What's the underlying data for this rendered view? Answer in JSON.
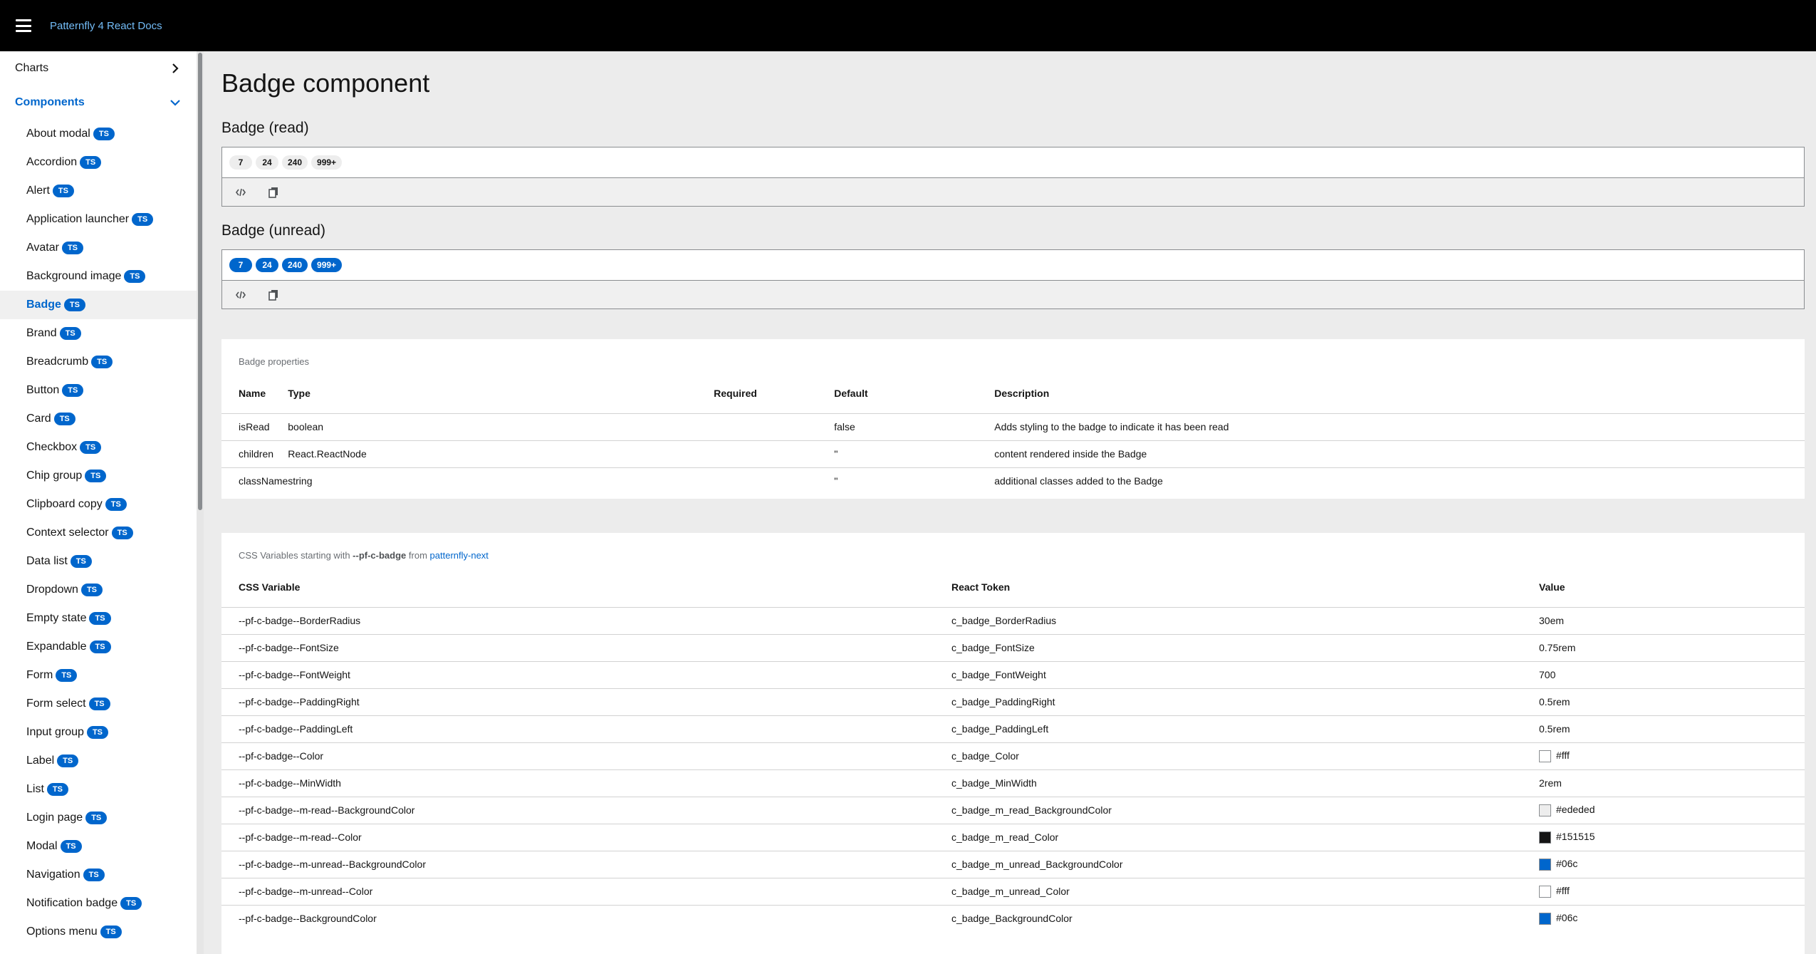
{
  "header": {
    "brand": "Patternfly 4 React Docs"
  },
  "sidebar": {
    "groups": [
      {
        "label": "Charts",
        "expanded": false
      },
      {
        "label": "Components",
        "expanded": true
      }
    ],
    "ts_label": "TS",
    "active_item": "Badge",
    "items": [
      {
        "label": "About modal"
      },
      {
        "label": "Accordion"
      },
      {
        "label": "Alert"
      },
      {
        "label": "Application launcher"
      },
      {
        "label": "Avatar"
      },
      {
        "label": "Background image"
      },
      {
        "label": "Badge"
      },
      {
        "label": "Brand"
      },
      {
        "label": "Breadcrumb"
      },
      {
        "label": "Button"
      },
      {
        "label": "Card"
      },
      {
        "label": "Checkbox"
      },
      {
        "label": "Chip group"
      },
      {
        "label": "Clipboard copy"
      },
      {
        "label": "Context selector"
      },
      {
        "label": "Data list"
      },
      {
        "label": "Dropdown"
      },
      {
        "label": "Empty state"
      },
      {
        "label": "Expandable"
      },
      {
        "label": "Form"
      },
      {
        "label": "Form select"
      },
      {
        "label": "Input group"
      },
      {
        "label": "Label"
      },
      {
        "label": "List"
      },
      {
        "label": "Login page"
      },
      {
        "label": "Modal"
      },
      {
        "label": "Navigation"
      },
      {
        "label": "Notification badge"
      },
      {
        "label": "Options menu"
      }
    ]
  },
  "main": {
    "title": "Badge component",
    "examples": [
      {
        "title": "Badge (read)",
        "variant": "read",
        "badges": [
          "7",
          "24",
          "240",
          "999+"
        ]
      },
      {
        "title": "Badge (unread)",
        "variant": "unread",
        "badges": [
          "7",
          "24",
          "240",
          "999+"
        ]
      }
    ],
    "props_table": {
      "caption": "Badge properties",
      "headers": [
        "Name",
        "Type",
        "Required",
        "Default",
        "Description"
      ],
      "rows": [
        [
          "isRead",
          "boolean",
          "",
          "false",
          "Adds styling to the badge to indicate it has been read"
        ],
        [
          "children",
          "React.ReactNode",
          "",
          "''",
          "content rendered inside the Badge"
        ],
        [
          "className",
          "string",
          "",
          "''",
          "additional classes added to the Badge"
        ]
      ]
    },
    "css_table": {
      "caption_prefix": "CSS Variables starting with",
      "caption_var": "--pf-c-badge",
      "caption_from": "from",
      "caption_link": "patternfly-next",
      "headers": [
        "CSS Variable",
        "React Token",
        "Value"
      ],
      "rows": [
        {
          "variable": "--pf-c-badge--BorderRadius",
          "token": "c_badge_BorderRadius",
          "value": "30em"
        },
        {
          "variable": "--pf-c-badge--FontSize",
          "token": "c_badge_FontSize",
          "value": "0.75rem"
        },
        {
          "variable": "--pf-c-badge--FontWeight",
          "token": "c_badge_FontWeight",
          "value": "700"
        },
        {
          "variable": "--pf-c-badge--PaddingRight",
          "token": "c_badge_PaddingRight",
          "value": "0.5rem"
        },
        {
          "variable": "--pf-c-badge--PaddingLeft",
          "token": "c_badge_PaddingLeft",
          "value": "0.5rem"
        },
        {
          "variable": "--pf-c-badge--Color",
          "token": "c_badge_Color",
          "value": "#fff",
          "swatch": "#ffffff"
        },
        {
          "variable": "--pf-c-badge--MinWidth",
          "token": "c_badge_MinWidth",
          "value": "2rem"
        },
        {
          "variable": "--pf-c-badge--m-read--BackgroundColor",
          "token": "c_badge_m_read_BackgroundColor",
          "value": "#ededed",
          "swatch": "#ededed"
        },
        {
          "variable": "--pf-c-badge--m-read--Color",
          "token": "c_badge_m_read_Color",
          "value": "#151515",
          "swatch": "#151515"
        },
        {
          "variable": "--pf-c-badge--m-unread--BackgroundColor",
          "token": "c_badge_m_unread_BackgroundColor",
          "value": "#06c",
          "swatch": "#0066cc"
        },
        {
          "variable": "--pf-c-badge--m-unread--Color",
          "token": "c_badge_m_unread_Color",
          "value": "#fff",
          "swatch": "#ffffff"
        },
        {
          "variable": "--pf-c-badge--BackgroundColor",
          "token": "c_badge_BackgroundColor",
          "value": "#06c",
          "swatch": "#0066cc"
        }
      ]
    }
  },
  "colors": {
    "accent": "#0066cc",
    "header_bg": "#000000",
    "brand_text": "#73bcf7",
    "page_bg": "#ececec"
  }
}
